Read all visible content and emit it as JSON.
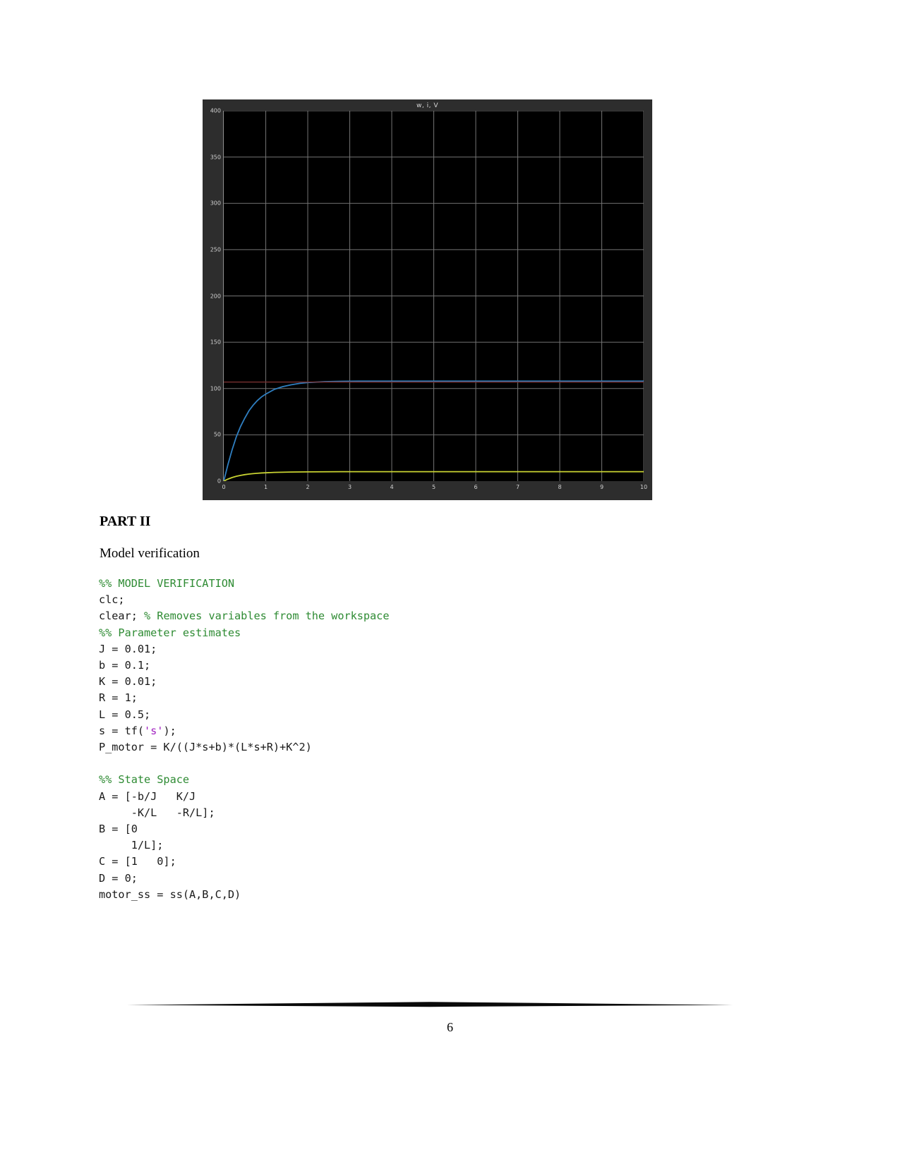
{
  "document": {
    "page_number": "6",
    "part_heading": "PART II",
    "subheading": "Model verification"
  },
  "chart_data": {
    "type": "line",
    "title": "w, i, V",
    "xlabel": "",
    "ylabel": "",
    "xlim": [
      0,
      10
    ],
    "ylim": [
      0,
      400
    ],
    "xticks": [
      "0",
      "1",
      "2",
      "3",
      "4",
      "5",
      "6",
      "7",
      "8",
      "9",
      "10"
    ],
    "yticks": [
      "0",
      "50",
      "100",
      "150",
      "200",
      "250",
      "300",
      "350",
      "400"
    ],
    "grid": true,
    "legend": "none",
    "background": "#000000",
    "panel": "#2d2d2d",
    "grid_color": "#9a9a9a",
    "series": [
      {
        "name": "w",
        "color": "#2f7fc1",
        "x": [
          0,
          0.1,
          0.2,
          0.3,
          0.4,
          0.5,
          0.6,
          0.7,
          0.8,
          0.9,
          1.0,
          1.2,
          1.4,
          1.6,
          1.8,
          2.0,
          2.4,
          2.8,
          3.2,
          3.6,
          4.0,
          5.0,
          6.0,
          7.0,
          8.0,
          9.0,
          10.0
        ],
        "y": [
          0,
          18,
          34,
          48,
          59,
          68,
          76,
          82,
          87,
          91,
          94,
          99,
          102,
          104,
          105.5,
          106.5,
          107.4,
          107.8,
          108,
          108,
          108,
          108,
          108,
          108,
          108,
          108,
          108
        ]
      },
      {
        "name": "i",
        "color": "#c8d232",
        "x": [
          0,
          0.1,
          0.2,
          0.3,
          0.4,
          0.5,
          0.6,
          0.7,
          0.8,
          0.9,
          1.0,
          1.2,
          1.4,
          1.6,
          1.8,
          2.0,
          2.4,
          2.8,
          3.2,
          3.6,
          4.0,
          5.0,
          6.0,
          7.0,
          8.0,
          9.0,
          10.0
        ],
        "y": [
          0,
          2.2,
          3.9,
          5.2,
          6.2,
          7.0,
          7.6,
          8.1,
          8.5,
          8.8,
          9.0,
          9.4,
          9.6,
          9.8,
          9.9,
          10.0,
          10.1,
          10.2,
          10.2,
          10.2,
          10.2,
          10.2,
          10.2,
          10.2,
          10.2,
          10.2,
          10.2
        ]
      },
      {
        "name": "V",
        "color": "#7a3030",
        "x": [
          0,
          10
        ],
        "y": [
          107,
          107
        ]
      }
    ]
  },
  "code": {
    "lines": [
      {
        "segments": [
          {
            "text": "%% MODEL VERIFICATION",
            "style": "cm"
          }
        ]
      },
      {
        "segments": [
          {
            "text": "clc;",
            "style": ""
          }
        ]
      },
      {
        "segments": [
          {
            "text": "clear; ",
            "style": ""
          },
          {
            "text": "% Removes variables from the workspace",
            "style": "cm"
          }
        ]
      },
      {
        "segments": [
          {
            "text": "%% Parameter estimates",
            "style": "cm"
          }
        ]
      },
      {
        "segments": [
          {
            "text": "J = 0.01;",
            "style": ""
          }
        ]
      },
      {
        "segments": [
          {
            "text": "b = 0.1;",
            "style": ""
          }
        ]
      },
      {
        "segments": [
          {
            "text": "K = 0.01;",
            "style": ""
          }
        ]
      },
      {
        "segments": [
          {
            "text": "R = 1;",
            "style": ""
          }
        ]
      },
      {
        "segments": [
          {
            "text": "L = 0.5;",
            "style": ""
          }
        ]
      },
      {
        "segments": [
          {
            "text": "s = tf(",
            "style": ""
          },
          {
            "text": "'s'",
            "style": "str"
          },
          {
            "text": ");",
            "style": ""
          }
        ]
      },
      {
        "segments": [
          {
            "text": "P_motor = K/((J*s+b)*(L*s+R)+K^2)",
            "style": ""
          }
        ]
      },
      {
        "segments": [
          {
            "text": " ",
            "style": ""
          }
        ]
      },
      {
        "segments": [
          {
            "text": "%% State Space",
            "style": "cm"
          }
        ]
      },
      {
        "segments": [
          {
            "text": "A = [-b/J   K/J",
            "style": ""
          }
        ]
      },
      {
        "segments": [
          {
            "text": "     -K/L   -R/L];",
            "style": ""
          }
        ]
      },
      {
        "segments": [
          {
            "text": "B = [0",
            "style": ""
          }
        ]
      },
      {
        "segments": [
          {
            "text": "     1/L];",
            "style": ""
          }
        ]
      },
      {
        "segments": [
          {
            "text": "C = [1   0];",
            "style": ""
          }
        ]
      },
      {
        "segments": [
          {
            "text": "D = 0;",
            "style": ""
          }
        ]
      },
      {
        "segments": [
          {
            "text": "motor_ss = ss(A,B,C,D)",
            "style": ""
          }
        ]
      }
    ]
  }
}
